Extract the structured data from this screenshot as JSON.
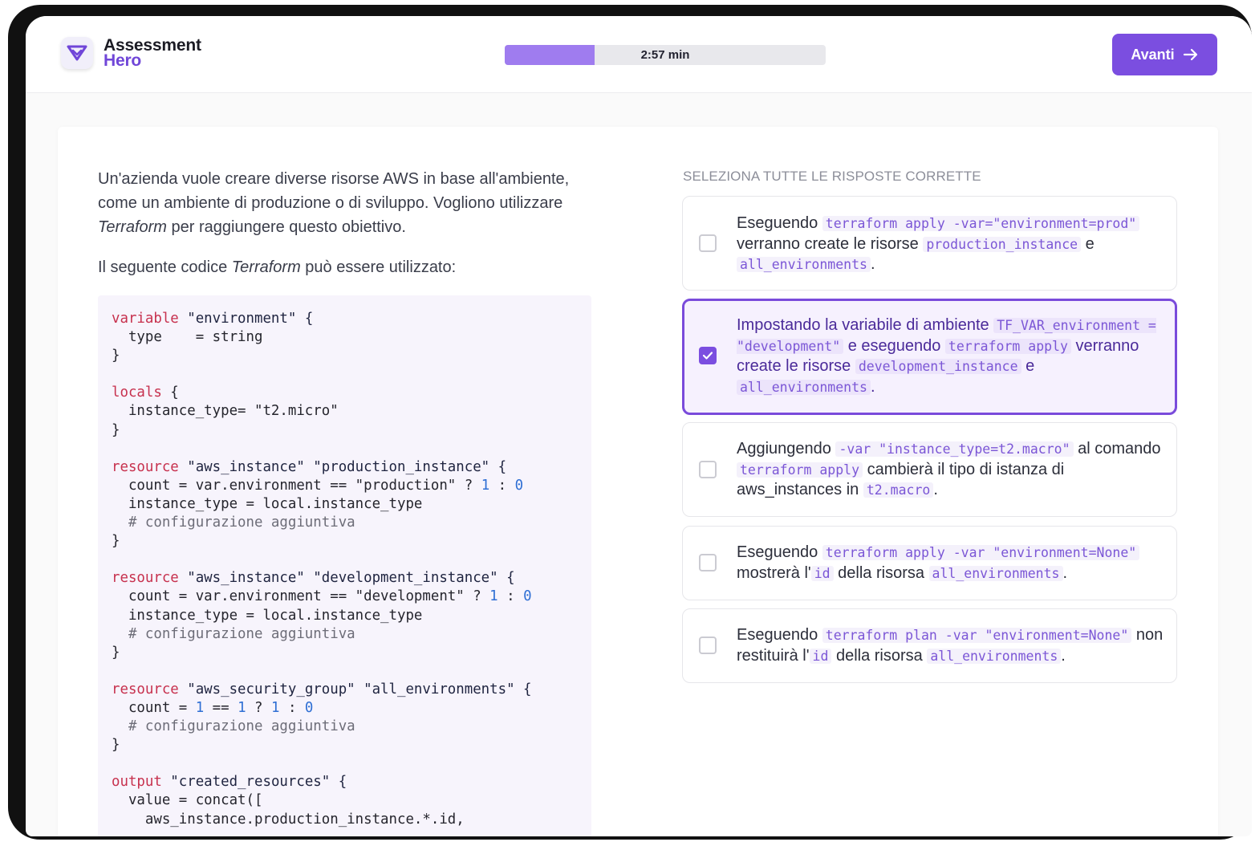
{
  "app": {
    "name_line1": "Assessment",
    "name_line2": "Hero"
  },
  "timer": {
    "label": "2:57 min",
    "progress_fraction": 0.28,
    "fill_color": "#9f7cef"
  },
  "nav": {
    "next_label": "Avanti",
    "next_icon": "arrow-right-icon",
    "accent": "#7b4ee0"
  },
  "question": {
    "p1_a": "Un'azienda vuole creare diverse risorse AWS in base all'ambiente, come un ambiente di produzione o di sviluppo. Vogliono utilizzare ",
    "p1_em": "Terraform",
    "p1_b": " per raggiungere questo obiettivo.",
    "p2_a": "Il seguente codice ",
    "p2_em": "Terraform",
    "p2_b": " può essere utilizzato:"
  },
  "code_lines": [
    [
      {
        "t": "kw",
        "v": "variable"
      },
      {
        "t": "str",
        "v": " \"environment\" {"
      }
    ],
    [
      {
        "t": "",
        "v": "  type    = string"
      }
    ],
    [
      {
        "t": "",
        "v": "}"
      }
    ],
    [
      {
        "t": "",
        "v": ""
      }
    ],
    [
      {
        "t": "kw",
        "v": "locals"
      },
      {
        "t": "",
        "v": " {"
      }
    ],
    [
      {
        "t": "",
        "v": "  instance_type= \"t2.micro\""
      }
    ],
    [
      {
        "t": "",
        "v": "}"
      }
    ],
    [
      {
        "t": "",
        "v": ""
      }
    ],
    [
      {
        "t": "kw",
        "v": "resource"
      },
      {
        "t": "str",
        "v": " \"aws_instance\" \"production_instance\" {"
      }
    ],
    [
      {
        "t": "",
        "v": "  count = var.environment == \"production\" ? "
      },
      {
        "t": "num",
        "v": "1"
      },
      {
        "t": "",
        "v": " : "
      },
      {
        "t": "num",
        "v": "0"
      }
    ],
    [
      {
        "t": "",
        "v": "  instance_type = local.instance_type"
      }
    ],
    [
      {
        "t": "cmt",
        "v": "  # configurazione aggiuntiva"
      }
    ],
    [
      {
        "t": "",
        "v": "}"
      }
    ],
    [
      {
        "t": "",
        "v": ""
      }
    ],
    [
      {
        "t": "kw",
        "v": "resource"
      },
      {
        "t": "str",
        "v": " \"aws_instance\" \"development_instance\" {"
      }
    ],
    [
      {
        "t": "",
        "v": "  count = var.environment == \"development\" ? "
      },
      {
        "t": "num",
        "v": "1"
      },
      {
        "t": "",
        "v": " : "
      },
      {
        "t": "num",
        "v": "0"
      }
    ],
    [
      {
        "t": "",
        "v": "  instance_type = local.instance_type"
      }
    ],
    [
      {
        "t": "cmt",
        "v": "  # configurazione aggiuntiva"
      }
    ],
    [
      {
        "t": "",
        "v": "}"
      }
    ],
    [
      {
        "t": "",
        "v": ""
      }
    ],
    [
      {
        "t": "kw",
        "v": "resource"
      },
      {
        "t": "str",
        "v": " \"aws_security_group\" \"all_environments\" {"
      }
    ],
    [
      {
        "t": "",
        "v": "  count = "
      },
      {
        "t": "num",
        "v": "1"
      },
      {
        "t": "",
        "v": " == "
      },
      {
        "t": "num",
        "v": "1"
      },
      {
        "t": "",
        "v": " ? "
      },
      {
        "t": "num",
        "v": "1"
      },
      {
        "t": "",
        "v": " : "
      },
      {
        "t": "num",
        "v": "0"
      }
    ],
    [
      {
        "t": "cmt",
        "v": "  # configurazione aggiuntiva"
      }
    ],
    [
      {
        "t": "",
        "v": "}"
      }
    ],
    [
      {
        "t": "",
        "v": ""
      }
    ],
    [
      {
        "t": "kw",
        "v": "output"
      },
      {
        "t": "str",
        "v": " \"created_resources\" {"
      }
    ],
    [
      {
        "t": "",
        "v": "  value = concat(["
      }
    ],
    [
      {
        "t": "",
        "v": "    aws_instance.production_instance.*.id,"
      }
    ]
  ],
  "instruction": "SELEZIONA TUTTE LE RISPOSTE CORRETTE",
  "options": [
    {
      "selected": false,
      "parts": [
        {
          "t": "text",
          "v": "Eseguendo "
        },
        {
          "t": "code",
          "v": "terraform apply -var=\"environment=prod\""
        },
        {
          "t": "text",
          "v": " verranno create le risorse "
        },
        {
          "t": "code",
          "v": "production_instance"
        },
        {
          "t": "text",
          "v": " e "
        },
        {
          "t": "code",
          "v": "all_environments"
        },
        {
          "t": "text",
          "v": "."
        }
      ]
    },
    {
      "selected": true,
      "parts": [
        {
          "t": "text",
          "v": "Impostando la variabile di ambiente "
        },
        {
          "t": "code",
          "v": "TF_VAR_environment = \"development\""
        },
        {
          "t": "text",
          "v": " e eseguendo "
        },
        {
          "t": "code",
          "v": "terraform apply"
        },
        {
          "t": "text",
          "v": " verranno create le risorse "
        },
        {
          "t": "code",
          "v": "development_instance"
        },
        {
          "t": "text",
          "v": " e "
        },
        {
          "t": "code",
          "v": "all_environments"
        },
        {
          "t": "text",
          "v": "."
        }
      ]
    },
    {
      "selected": false,
      "parts": [
        {
          "t": "text",
          "v": "Aggiungendo "
        },
        {
          "t": "code",
          "v": "-var \"instance_type=t2.macro\""
        },
        {
          "t": "text",
          "v": " al comando "
        },
        {
          "t": "code",
          "v": "terraform apply"
        },
        {
          "t": "text",
          "v": " cambierà il tipo di istanza di aws_instances in "
        },
        {
          "t": "code",
          "v": "t2.macro"
        },
        {
          "t": "text",
          "v": "."
        }
      ]
    },
    {
      "selected": false,
      "parts": [
        {
          "t": "text",
          "v": "Eseguendo "
        },
        {
          "t": "code",
          "v": "terraform apply -var \"environment=None\""
        },
        {
          "t": "text",
          "v": " mostrerà l'"
        },
        {
          "t": "code",
          "v": "id"
        },
        {
          "t": "text",
          "v": " della risorsa "
        },
        {
          "t": "code",
          "v": "all_environments"
        },
        {
          "t": "text",
          "v": "."
        }
      ]
    },
    {
      "selected": false,
      "parts": [
        {
          "t": "text",
          "v": "Eseguendo "
        },
        {
          "t": "code",
          "v": "terraform plan -var \"environment=None\""
        },
        {
          "t": "text",
          "v": " non restituirà l'"
        },
        {
          "t": "code",
          "v": "id"
        },
        {
          "t": "text",
          "v": " della risorsa "
        },
        {
          "t": "code",
          "v": "all_environments"
        },
        {
          "t": "text",
          "v": "."
        }
      ]
    }
  ]
}
